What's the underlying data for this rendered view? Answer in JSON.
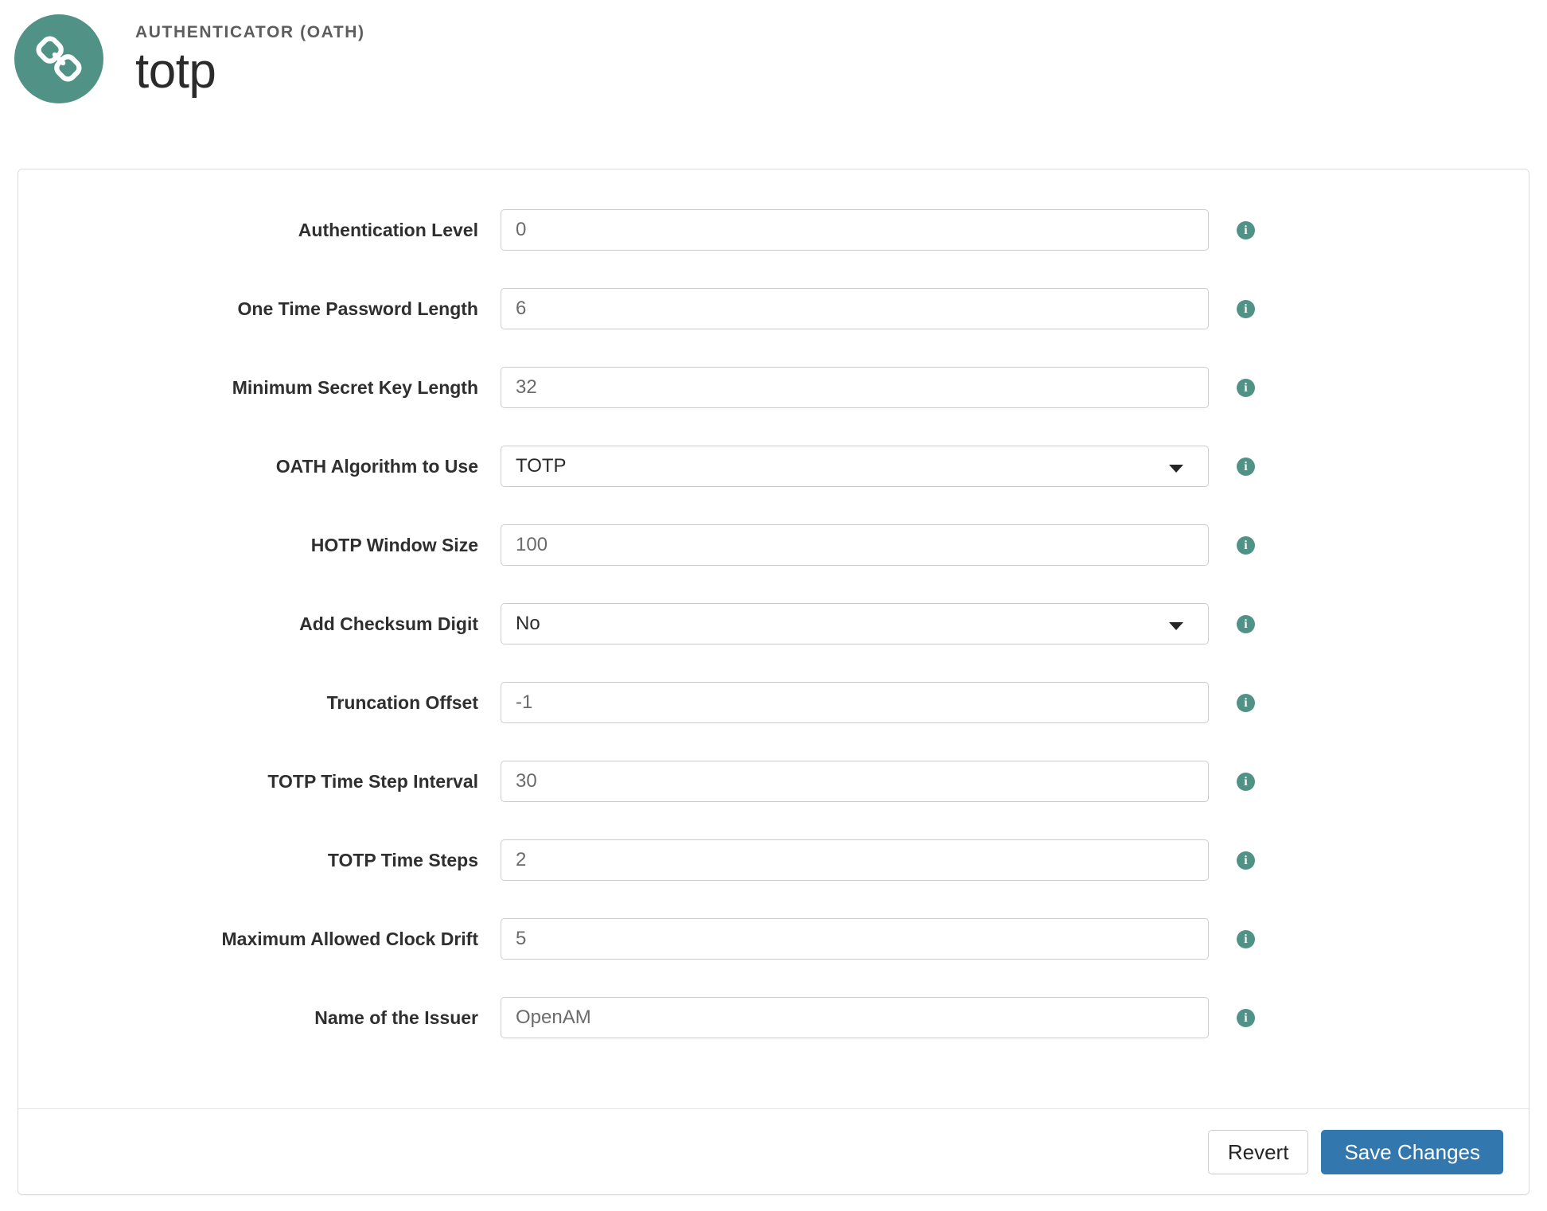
{
  "header": {
    "avatar_icon": "chain-link-icon",
    "eyebrow": "AUTHENTICATOR (OATH)",
    "title": "totp",
    "avatar_color": "#519287"
  },
  "form": {
    "info_icon": "info-icon",
    "caret_icon": "chevron-down-icon",
    "rows": [
      {
        "label": "Authentication Level",
        "type": "text",
        "value": "0"
      },
      {
        "label": "One Time Password Length",
        "type": "text",
        "value": "6"
      },
      {
        "label": "Minimum Secret Key Length",
        "type": "text",
        "value": "32"
      },
      {
        "label": "OATH Algorithm to Use",
        "type": "select",
        "value": "TOTP"
      },
      {
        "label": "HOTP Window Size",
        "type": "text",
        "value": "100"
      },
      {
        "label": "Add Checksum Digit",
        "type": "select",
        "value": "No"
      },
      {
        "label": "Truncation Offset",
        "type": "text",
        "value": "-1"
      },
      {
        "label": "TOTP Time Step Interval",
        "type": "text",
        "value": "30"
      },
      {
        "label": "TOTP Time Steps",
        "type": "text",
        "value": "2"
      },
      {
        "label": "Maximum Allowed Clock Drift",
        "type": "text",
        "value": "5"
      },
      {
        "label": "Name of the Issuer",
        "type": "text",
        "value": "OpenAM"
      }
    ]
  },
  "footer": {
    "revert_label": "Revert",
    "save_label": "Save Changes",
    "primary_color": "#3277ad"
  }
}
